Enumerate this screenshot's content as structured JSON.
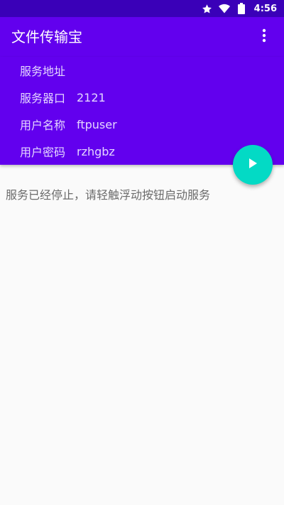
{
  "status_bar": {
    "time": "4:56",
    "icons": [
      "star-icon",
      "wifi-icon",
      "battery-icon"
    ],
    "background": "#3a00b8"
  },
  "app_bar": {
    "title": "文件传输宝",
    "menu_icon": "more-vert-icon",
    "background": "#6200ee"
  },
  "server_info": {
    "rows": [
      {
        "label": "服务地址",
        "value": ""
      },
      {
        "label": "服务器口",
        "value": "2121"
      },
      {
        "label": "用户名称",
        "value": "ftpuser"
      },
      {
        "label": "用户密码",
        "value": "rzhgbz"
      }
    ]
  },
  "fab": {
    "icon": "play-icon",
    "color": "#03dac5"
  },
  "main": {
    "status_message": "服务已经停止，请轻触浮动按钮启动服务"
  }
}
